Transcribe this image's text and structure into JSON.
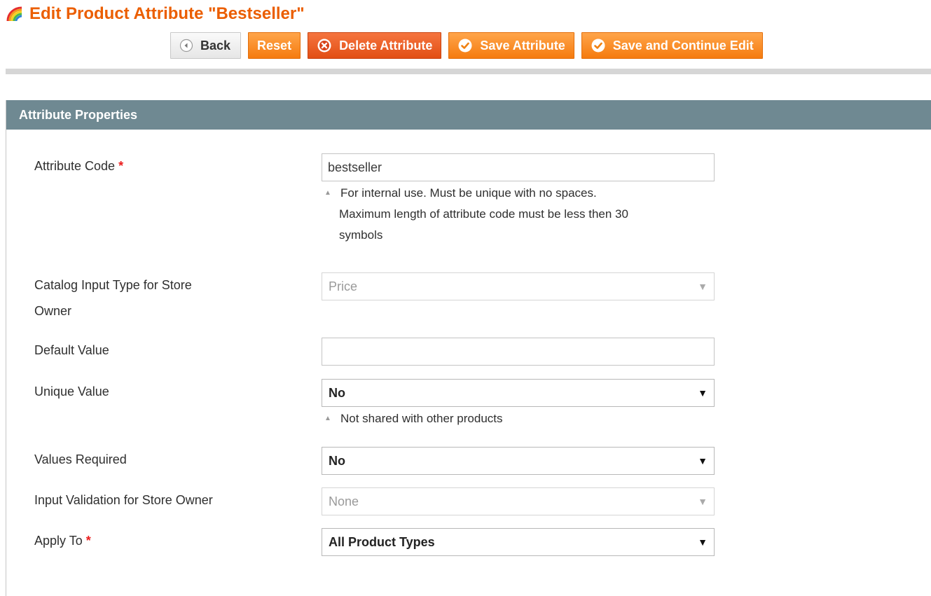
{
  "header": {
    "title": "Edit Product Attribute \"Bestseller\"",
    "icon": "rainbow-icon"
  },
  "toolbar": {
    "back_label": "Back",
    "reset_label": "Reset",
    "delete_label": "Delete Attribute",
    "save_label": "Save Attribute",
    "save_continue_label": "Save and Continue Edit"
  },
  "section": {
    "title": "Attribute Properties"
  },
  "fields": {
    "attribute_code": {
      "label": "Attribute Code",
      "required_mark": "*",
      "value": "bestseller",
      "note_line1": "For internal use. Must be unique with no spaces.",
      "note_line2": "Maximum length of attribute code must be less then 30",
      "note_line3": "symbols"
    },
    "input_type": {
      "label_line1": "Catalog Input Type for Store",
      "label_line2": "Owner",
      "value": "Price"
    },
    "default_value": {
      "label": "Default Value",
      "value": ""
    },
    "unique_value": {
      "label": "Unique Value",
      "value": "No",
      "note": "Not shared with other products"
    },
    "values_required": {
      "label": "Values Required",
      "value": "No"
    },
    "input_validation": {
      "label": "Input Validation for Store Owner",
      "value": "None"
    },
    "apply_to": {
      "label": "Apply To",
      "required_mark": "*",
      "value": "All Product Types"
    }
  },
  "colors": {
    "accent": "#eb5e00",
    "section_header": "#6f8992",
    "button_orange": "#f57b0f",
    "button_delete": "#e24e14",
    "required": "#eb1e1e"
  }
}
